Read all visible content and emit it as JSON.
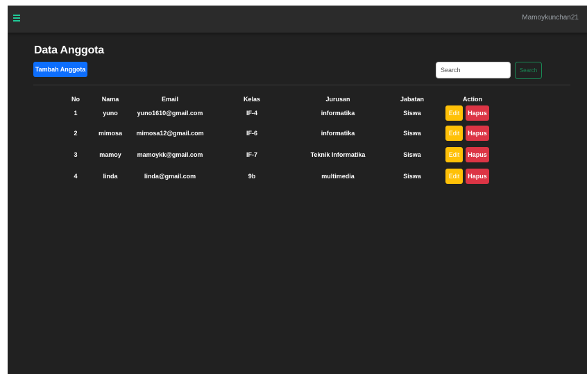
{
  "navbar": {
    "menu_icon": "hamburger-menu-icon",
    "username": "Mamoykunchan21",
    "accent_color": "#20c997"
  },
  "page": {
    "title": "Data Anggota",
    "add_button_label": "Tambah Anggota"
  },
  "search": {
    "placeholder": "Search",
    "value": "",
    "button_label": "Search"
  },
  "table": {
    "columns": [
      "No",
      "Nama",
      "Email",
      "Kelas",
      "Jurusan",
      "Jabatan",
      "Action"
    ],
    "rows": [
      {
        "no": "1",
        "nama": "yuno",
        "email": "yuno1610@gmail.com",
        "kelas": "IF-4",
        "jurusan": "informatika",
        "jabatan": "Siswa",
        "edit": "Edit",
        "hapus": "Hapus"
      },
      {
        "no": "2",
        "nama": "mimosa",
        "email": "mimosa12@gmail.com",
        "kelas": "IF-6",
        "jurusan": "informatika",
        "jabatan": "Siswa",
        "edit": "Edit",
        "hapus": "Hapus"
      },
      {
        "no": "3",
        "nama": "mamoy",
        "email": "mamoykk@gmail.com",
        "kelas": "IF-7",
        "jurusan": "Teknik Informatika",
        "jabatan": "Siswa",
        "edit": "Edit",
        "hapus": "Hapus"
      },
      {
        "no": "4",
        "nama": "linda",
        "email": "linda@gmail.com",
        "kelas": "9b",
        "jurusan": "multimedia",
        "jabatan": "Siswa",
        "edit": "Edit",
        "hapus": "Hapus"
      }
    ]
  },
  "colors": {
    "background": "#212121",
    "navbar": "#2b2b2b",
    "primary": "#0d6efd",
    "warning": "#ffc107",
    "danger": "#dc3545",
    "success": "#198754"
  }
}
